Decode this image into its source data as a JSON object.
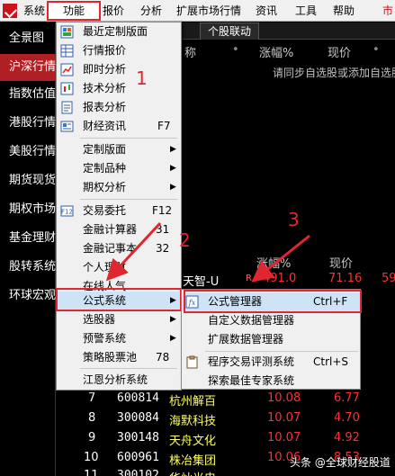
{
  "menubar": {
    "items": [
      "系统",
      "功能",
      "报价",
      "分析",
      "扩展市场行情",
      "资讯",
      "工具",
      "帮助"
    ],
    "right_text": "市"
  },
  "sidebar": {
    "items": [
      "全景图",
      "沪深行情",
      "指数估值",
      "港股行情",
      "美股行情",
      "期货现货",
      "期权市场",
      "基金理财",
      "股转系统",
      "环球宏观"
    ]
  },
  "main": {
    "tab": "个股联动",
    "header_top": {
      "name": "称",
      "dot": "•",
      "change": "涨幅%",
      "price": "现价",
      "dot2": "•"
    },
    "hint": "请同步自选股或添加自选股",
    "header_mid": {
      "change": "涨幅%",
      "price": "现价"
    },
    "highlight_row": {
      "name": "天智-U",
      "flag": "R",
      "change": "491.0",
      "price": "71.16",
      "extra": "59"
    },
    "rows": [
      {
        "idx": "7",
        "code": "600814",
        "name": "杭州解百",
        "change": "10.08",
        "price": "6.77"
      },
      {
        "idx": "8",
        "code": "300084",
        "name": "海默科技",
        "change": "10.07",
        "price": "4.70"
      },
      {
        "idx": "9",
        "code": "300148",
        "name": "天舟文化",
        "change": "10.07",
        "price": "4.92"
      },
      {
        "idx": "10",
        "code": "600961",
        "name": "株冶集团",
        "change": "10.06",
        "price": "8.53"
      },
      {
        "idx": "11",
        "code": "300102",
        "name": "华灿光电",
        "change": "",
        "price": ""
      }
    ]
  },
  "func_menu": {
    "items": [
      {
        "label": "最近定制版面",
        "shortcut": ""
      },
      {
        "label": "行情报价",
        "shortcut": ""
      },
      {
        "label": "即时分析",
        "shortcut": ""
      },
      {
        "label": "技术分析",
        "shortcut": ""
      },
      {
        "label": "报表分析",
        "shortcut": ""
      },
      {
        "label": "财经资讯",
        "shortcut": "F7"
      },
      {
        "label": "定制版面",
        "shortcut": ""
      },
      {
        "label": "定制品种",
        "shortcut": ""
      },
      {
        "label": "期权分析",
        "shortcut": ""
      },
      {
        "label": "交易委托",
        "shortcut": "F12"
      },
      {
        "label": "金融计算器",
        "shortcut": "31"
      },
      {
        "label": "金融记事本",
        "shortcut": "32"
      },
      {
        "label": "个人理财",
        "shortcut": ""
      },
      {
        "label": "在线人气",
        "shortcut": ""
      },
      {
        "label": "公式系统",
        "shortcut": ""
      },
      {
        "label": "选股器",
        "shortcut": ""
      },
      {
        "label": "预警系统",
        "shortcut": ""
      },
      {
        "label": "策略股票池",
        "shortcut": "78"
      },
      {
        "label": "江恩分析系统",
        "shortcut": ""
      }
    ]
  },
  "formula_menu": {
    "items": [
      {
        "label": "公式管理器",
        "shortcut": "Ctrl+F"
      },
      {
        "label": "自定义数据管理器",
        "shortcut": ""
      },
      {
        "label": "扩展数据管理器",
        "shortcut": ""
      },
      {
        "label": "程序交易评测系统",
        "shortcut": "Ctrl+S"
      },
      {
        "label": "探索最佳专家系统",
        "shortcut": ""
      }
    ]
  },
  "annotations": [
    "1",
    "2",
    "3"
  ],
  "watermark": "头条 @全球财经股道",
  "colors": {
    "highlight_red": "#e0262e",
    "up_red": "#ff3030",
    "name_yellow": "#ffff66",
    "active_side": "#b01f24"
  }
}
